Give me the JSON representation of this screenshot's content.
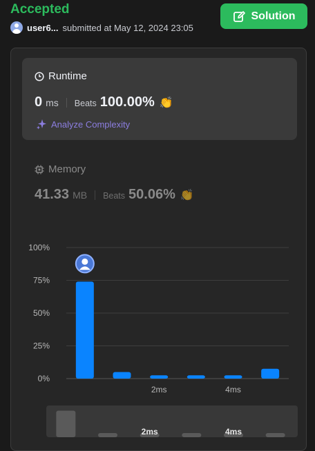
{
  "header": {
    "status": "Accepted",
    "username": "user6...",
    "submitted_text": "submitted at May 12, 2024 23:05",
    "solution_label": "Solution"
  },
  "colors": {
    "accent_green": "#2cbb5d",
    "bar_blue": "#0a84ff",
    "analyze_purple": "#8c7ee0"
  },
  "runtime": {
    "title": "Runtime",
    "value": "0",
    "unit": "ms",
    "beats_label": "Beats",
    "beats_value": "100.00%",
    "analyze_label": "Analyze Complexity"
  },
  "memory": {
    "title": "Memory",
    "value": "41.33",
    "unit": "MB",
    "beats_label": "Beats",
    "beats_value": "50.06%"
  },
  "icons": [
    "clock-icon",
    "chip-icon",
    "sparkle-icon",
    "clap-icon",
    "edit-icon",
    "avatar"
  ],
  "chart_data": {
    "type": "bar",
    "x": [
      0,
      1,
      2,
      3,
      4,
      5
    ],
    "values": [
      74,
      5,
      2.5,
      2.5,
      2.5,
      7.5
    ],
    "highlight_index": 0,
    "ylim": [
      0,
      100
    ],
    "yticks": [
      "0%",
      "25%",
      "50%",
      "75%",
      "100%"
    ],
    "xtick_labels": [
      "2ms",
      "4ms"
    ],
    "grid": true,
    "overview_labels": [
      "2ms",
      "4ms"
    ]
  }
}
